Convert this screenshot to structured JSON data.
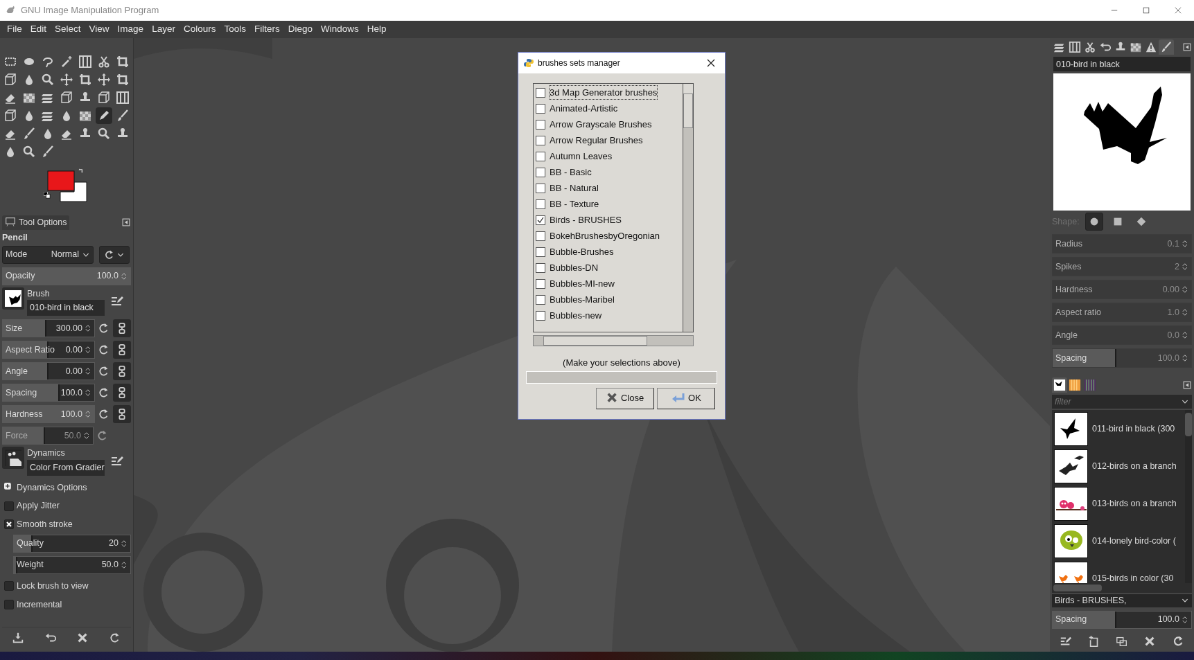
{
  "window": {
    "title": "GNU Image Manipulation Program"
  },
  "menu": [
    "File",
    "Edit",
    "Select",
    "View",
    "Image",
    "Layer",
    "Colours",
    "Tools",
    "Filters",
    "Diego",
    "Windows",
    "Help"
  ],
  "toolbox": {
    "tools": [
      {
        "selected": false
      },
      {
        "selected": false
      },
      {
        "selected": false
      },
      {
        "selected": false
      },
      {
        "selected": false
      },
      {
        "selected": false
      },
      {
        "selected": false
      },
      {
        "selected": false
      },
      {
        "selected": false
      },
      {
        "selected": false
      },
      {
        "selected": false
      },
      {
        "selected": false
      },
      {
        "selected": false
      },
      {
        "selected": false
      },
      {
        "selected": false
      },
      {
        "selected": false
      },
      {
        "selected": false
      },
      {
        "selected": false
      },
      {
        "selected": false
      },
      {
        "selected": false
      },
      {
        "selected": false
      },
      {
        "selected": false
      },
      {
        "selected": false
      },
      {
        "selected": false
      },
      {
        "selected": false
      },
      {
        "selected": false
      },
      {
        "selected": true
      },
      {
        "selected": false
      },
      {
        "selected": false
      },
      {
        "selected": false
      },
      {
        "selected": false
      },
      {
        "selected": false
      },
      {
        "selected": false
      },
      {
        "selected": false
      },
      {
        "selected": false
      },
      {
        "selected": false
      },
      {
        "selected": false
      },
      {
        "selected": false
      }
    ],
    "colors": [
      {
        "color": "#e8171a"
      },
      {
        "color": "#ffffff"
      }
    ]
  },
  "tool_options": {
    "tab": "Tool Options",
    "tool": "Pencil",
    "mode": {
      "label": "Mode",
      "value": "Normal"
    },
    "controls": [
      {
        "kind": "slider",
        "label": "Opacity",
        "value": "100.0",
        "level": 1,
        "disabled": false
      },
      {
        "kind": "brush",
        "label": "Brush",
        "value": "010-bird in black",
        "disabled": false
      },
      {
        "kind": "linked",
        "label": "Size",
        "value": "300.00",
        "level": 0.48,
        "disabled": false
      },
      {
        "kind": "linked",
        "label": "Aspect Ratio",
        "value": "0.00",
        "level": 0.5,
        "disabled": false
      },
      {
        "kind": "linked",
        "label": "Angle",
        "value": "0.00",
        "level": 0.5,
        "disabled": false
      },
      {
        "kind": "linked",
        "label": "Spacing",
        "value": "100.0",
        "level": 0.62,
        "disabled": false
      },
      {
        "kind": "linked",
        "label": "Hardness",
        "value": "100.0",
        "level": 1,
        "disabled": false
      },
      {
        "kind": "reset",
        "label": "Force",
        "value": "50.0",
        "level": 0.47,
        "disabled": true
      },
      {
        "kind": "dynamics",
        "label": "Dynamics",
        "value": "Color From Gradier",
        "disabled": false
      },
      {
        "kind": "expander",
        "label": "Dynamics Options",
        "expanded": false,
        "disabled": false
      },
      {
        "kind": "checkbox",
        "label": "Apply Jitter",
        "checked": false,
        "disabled": false
      },
      {
        "kind": "checkbox",
        "label": "Smooth stroke",
        "checked": true,
        "disabled": false
      },
      {
        "kind": "subslider",
        "label": "Quality",
        "value": "20",
        "level": 0.16,
        "disabled": false
      },
      {
        "kind": "subslider",
        "label": "Weight",
        "value": "50.0",
        "level": 0.03,
        "disabled": false
      },
      {
        "kind": "checkbox",
        "label": "Lock brush to view",
        "checked": false,
        "disabled": false
      },
      {
        "kind": "checkbox",
        "label": "Incremental",
        "checked": false,
        "disabled": false
      }
    ]
  },
  "dialog": {
    "title": "brushes sets manager",
    "items": [
      {
        "label": "3d Map Generator brushes",
        "checked": false,
        "focused": true
      },
      {
        "label": "Animated-Artistic",
        "checked": false,
        "focused": false
      },
      {
        "label": "Arrow Grayscale Brushes",
        "checked": false,
        "focused": false
      },
      {
        "label": "Arrow Regular Brushes",
        "checked": false,
        "focused": false
      },
      {
        "label": "Autumn Leaves",
        "checked": false,
        "focused": false
      },
      {
        "label": "BB - Basic",
        "checked": false,
        "focused": false
      },
      {
        "label": "BB - Natural",
        "checked": false,
        "focused": false
      },
      {
        "label": "BB - Texture",
        "checked": false,
        "focused": false
      },
      {
        "label": "Birds - BRUSHES",
        "checked": true,
        "focused": false
      },
      {
        "label": "BokehBrushesbyOregonian",
        "checked": false,
        "focused": false
      },
      {
        "label": "Bubble-Brushes",
        "checked": false,
        "focused": false
      },
      {
        "label": "Bubbles-DN",
        "checked": false,
        "focused": false
      },
      {
        "label": "Bubbles-MI-new",
        "checked": false,
        "focused": false
      },
      {
        "label": "Bubbles-Maribel",
        "checked": false,
        "focused": false
      },
      {
        "label": "Bubbles-new",
        "checked": false,
        "focused": false
      }
    ],
    "status": "(Make your selections above)",
    "progress": {
      "level": 0
    },
    "buttons": [
      "Close",
      "OK"
    ]
  },
  "brush_editor": {
    "tabs": [
      {
        "selected": false
      },
      {
        "selected": false
      },
      {
        "selected": false
      },
      {
        "selected": false
      },
      {
        "selected": false
      },
      {
        "selected": false
      },
      {
        "selected": false
      },
      {
        "selected": true
      }
    ],
    "name": "010-bird in black",
    "shape": {
      "label": "Shape:",
      "options": [
        {
          "selected": true
        },
        {
          "selected": false
        },
        {
          "selected": false
        }
      ]
    },
    "sliders": [
      {
        "label": "Radius",
        "value": "0.1",
        "disabled": true
      },
      {
        "label": "Spikes",
        "value": "2",
        "disabled": true
      },
      {
        "label": "Hardness",
        "value": "0.00",
        "disabled": true
      },
      {
        "label": "Aspect ratio",
        "value": "1.0",
        "disabled": true
      },
      {
        "label": "Angle",
        "value": "0.0",
        "disabled": true
      },
      {
        "label": "Spacing",
        "value": "100.0",
        "level": 0.46,
        "disabled": true
      }
    ]
  },
  "brushes": {
    "tabs": [
      {
        "selected": true
      },
      {
        "selected": false
      },
      {
        "selected": false
      }
    ],
    "filter": {
      "placeholder": "filter"
    },
    "items": [
      {
        "name": "011-bird in black (300",
        "kind": "silhouette"
      },
      {
        "name": "012-birds on a branch",
        "kind": "flock"
      },
      {
        "name": "013-birds on a branch",
        "kind": "owls"
      },
      {
        "name": "014-lonely bird-color (",
        "kind": "round"
      },
      {
        "name": "015-birds in color (30",
        "kind": "pair"
      }
    ],
    "tag": "Birds - BRUSHES,",
    "spacing": {
      "label": "Spacing",
      "value": "100.0",
      "level": 0.46
    }
  }
}
